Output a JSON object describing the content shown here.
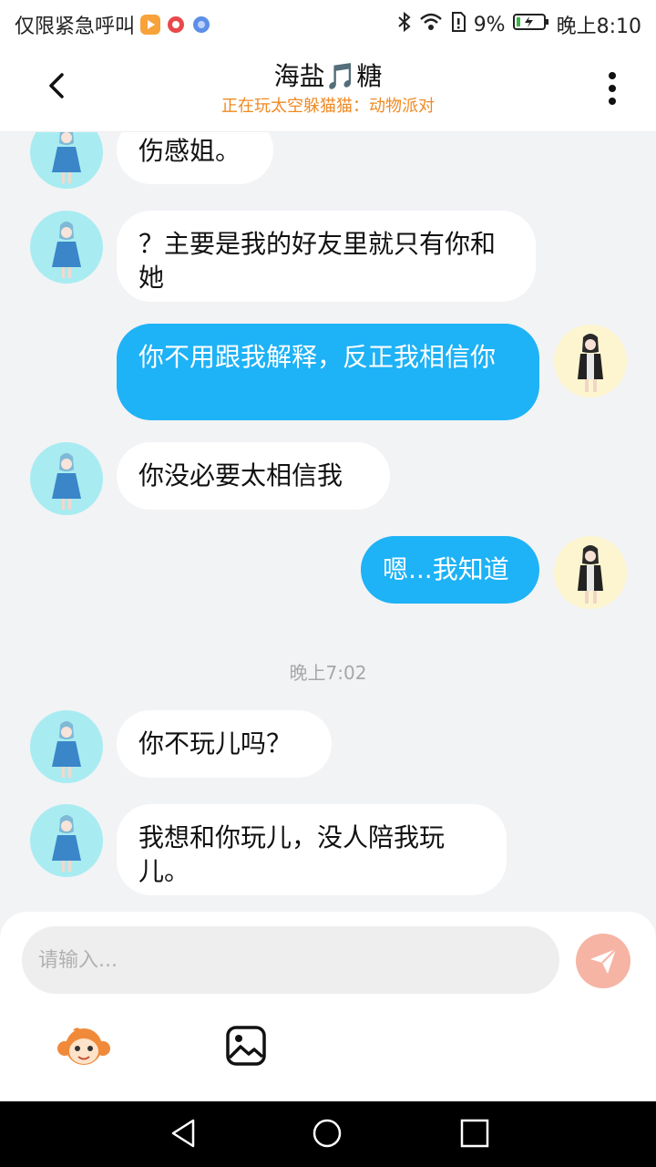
{
  "status_bar": {
    "left_text": "仅限紧急呼叫",
    "battery": "9%",
    "time": "晚上8:10",
    "icons": [
      "video-app-icon",
      "red-app-icon",
      "blue-app-icon",
      "bluetooth-icon",
      "wifi-icon",
      "sim-icon",
      "battery-icon"
    ]
  },
  "header": {
    "title": "海盐🎵糖",
    "subtitle": "正在玩太空躲猫猫：动物派对",
    "subtitle_color": "#f08a24"
  },
  "messages": [
    {
      "side": "peer",
      "text": "伤感姐。"
    },
    {
      "side": "peer",
      "text": "？主要是我的好友里就只有你和她"
    },
    {
      "side": "self",
      "text": "你不用跟我解释，反正我相信你"
    },
    {
      "side": "peer",
      "text": "你没必要太相信我"
    },
    {
      "side": "self",
      "text": "嗯...我知道"
    },
    {
      "side": "peer",
      "text": "你不玩儿吗？"
    },
    {
      "side": "peer",
      "text": "我想和你玩儿，没人陪我玩儿。"
    }
  ],
  "timestamp": "晚上7:02",
  "composer": {
    "placeholder": "请输入...",
    "send_color": "#f6b4a4"
  },
  "colors": {
    "self_bubble": "#1eb2f6",
    "peer_bubble": "#ffffff",
    "background": "#f2f3f5"
  }
}
